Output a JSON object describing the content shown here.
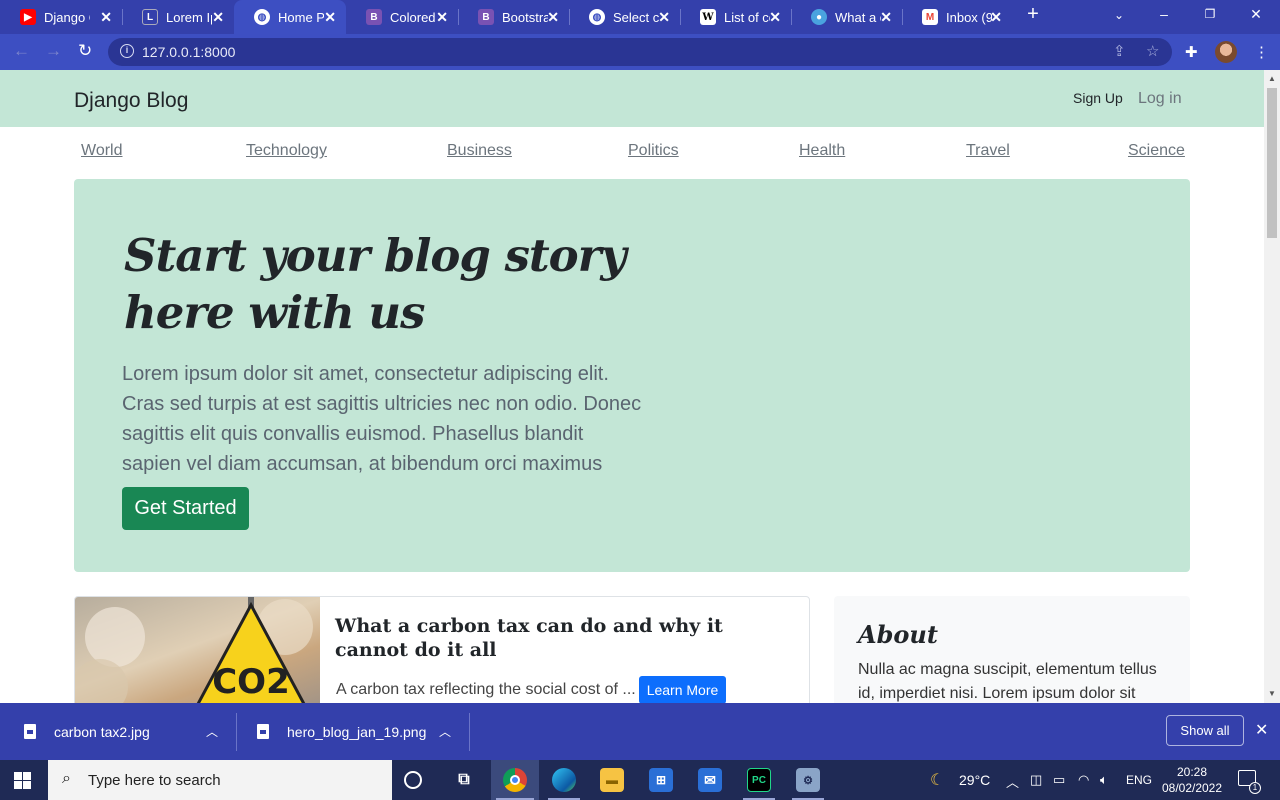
{
  "browser": {
    "tabs": [
      {
        "title": "Django C",
        "favicon": "youtube-icon",
        "color": "#ff0000"
      },
      {
        "title": "Lorem Ip",
        "favicon": "lorem-icon",
        "color": "#2b3590"
      },
      {
        "title": "Home Pa",
        "favicon": "globe-icon",
        "color": "#ffffff",
        "active": true
      },
      {
        "title": "Colored",
        "favicon": "bootstrap-icon",
        "color": "#7952b3"
      },
      {
        "title": "Bootstrap",
        "favicon": "bootstrap-icon",
        "color": "#7952b3"
      },
      {
        "title": "Select ca",
        "favicon": "globe-icon",
        "color": "#ffffff"
      },
      {
        "title": "List of co",
        "favicon": "wikipedia-icon",
        "color": "#ffffff"
      },
      {
        "title": "What a c",
        "favicon": "site-icon",
        "color": "#4aa3df"
      },
      {
        "title": "Inbox (9",
        "favicon": "gmail-icon",
        "color": "#ea4335"
      }
    ],
    "url": "127.0.0.1:8000"
  },
  "site": {
    "brand": "Django Blog",
    "signup": "Sign Up",
    "login": "Log in",
    "categories": [
      "World",
      "Technology",
      "Business",
      "Politics",
      "Health",
      "Travel",
      "Science"
    ],
    "hero": {
      "title": "Start your blog story here with us",
      "text": "Lorem ipsum dolor sit amet, consectetur adipiscing elit. Cras sed turpis at est sagittis ultricies nec non odio. Donec sagittis elit quis convallis euismod. Phasellus blandit sapien vel diam accumsan, at bibendum orci maximus",
      "button": "Get Started"
    },
    "post": {
      "title": "What a carbon tax can do and why it cannot do it all",
      "excerpt": "A carbon tax reflecting the social cost of ...",
      "button": "Learn More",
      "image_label": "CO2"
    },
    "about": {
      "title": "About",
      "text": "Nulla ac magna suscipit, elementum tellus id, imperdiet nisi. Lorem ipsum dolor sit"
    }
  },
  "downloads": {
    "items": [
      "carbon tax2.jpg",
      "hero_blog_jan_19.png"
    ],
    "show_all": "Show all"
  },
  "taskbar": {
    "search_placeholder": "Type here to search",
    "temperature": "29°C",
    "language": "ENG",
    "time": "20:28",
    "date": "08/02/2022",
    "notification_count": "1"
  },
  "colors": {
    "brand_header": "#c3e6d6",
    "browser_frame": "#3440ab",
    "primary_button": "#0d6efd",
    "success_button": "#198754"
  }
}
